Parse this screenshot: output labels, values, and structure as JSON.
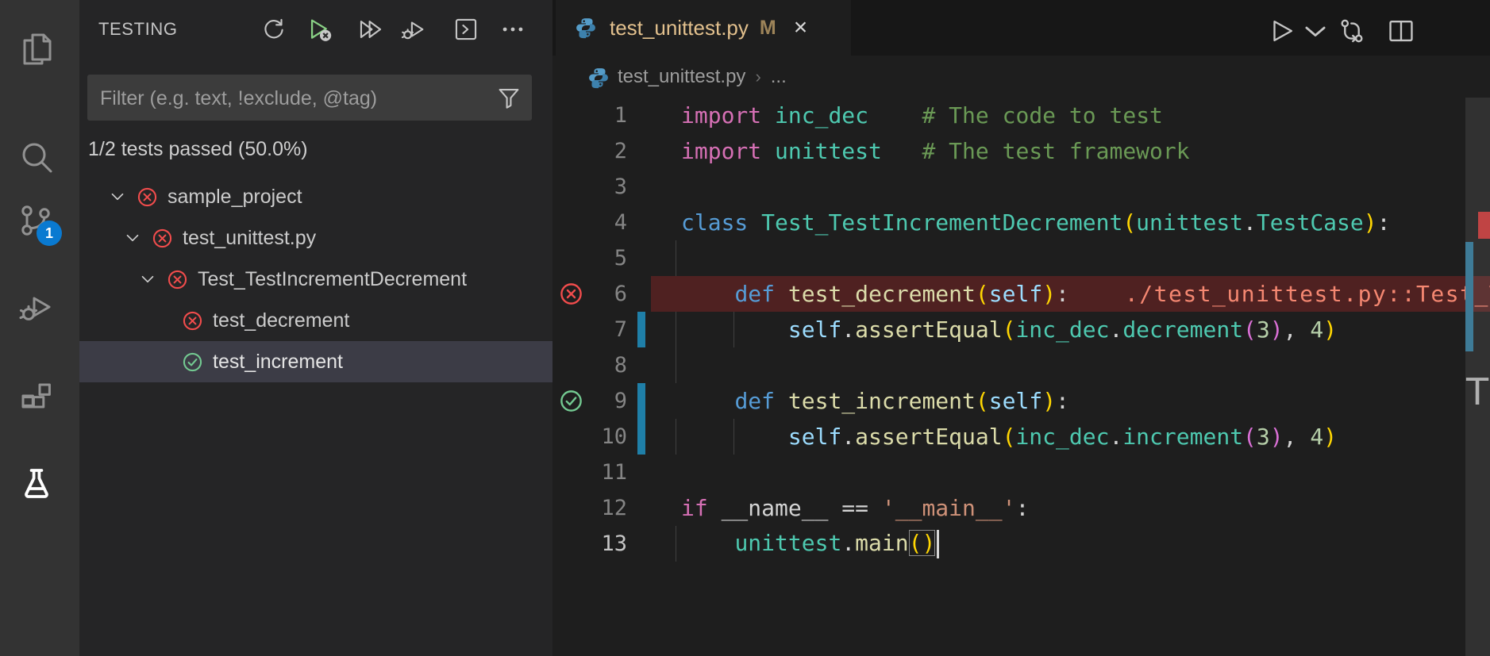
{
  "activity_bar": {
    "items": [
      {
        "icon": "explorer-icon"
      },
      {
        "icon": "search-icon"
      },
      {
        "icon": "source-control-icon",
        "badge": "1"
      },
      {
        "icon": "run-and-debug-icon"
      },
      {
        "icon": "extensions-icon"
      },
      {
        "icon": "testing-icon",
        "active": true
      }
    ]
  },
  "sidebar": {
    "title": "TESTING",
    "toolbar": [
      {
        "name": "refresh-tests"
      },
      {
        "name": "run-failed-tests"
      },
      {
        "name": "run-all-tests"
      },
      {
        "name": "debug-tests"
      },
      {
        "name": "show-output"
      },
      {
        "name": "more-actions"
      }
    ],
    "filter": {
      "placeholder": "Filter (e.g. text, !exclude, @tag)"
    },
    "summary": "1/2 tests passed (50.0%)",
    "tree": [
      {
        "label": "sample_project",
        "state": "fail",
        "level": 0,
        "expandable": true
      },
      {
        "label": "test_unittest.py",
        "state": "fail",
        "level": 1,
        "expandable": true
      },
      {
        "label": "Test_TestIncrementDecrement",
        "state": "fail",
        "level": 2,
        "expandable": true
      },
      {
        "label": "test_decrement",
        "state": "fail",
        "level": 3,
        "expandable": false
      },
      {
        "label": "test_increment",
        "state": "pass",
        "level": 3,
        "expandable": false,
        "selected": true
      }
    ]
  },
  "editor": {
    "tab": {
      "title": "test_unittest.py",
      "dirty_badge": "M",
      "close": "×",
      "icon": "python-icon"
    },
    "actions": [
      {
        "name": "run-file"
      },
      {
        "name": "run-dropdown-chevron"
      },
      {
        "name": "open-changes"
      },
      {
        "name": "split-editor"
      },
      {
        "name": "more-actions"
      }
    ],
    "breadcrumb": {
      "file": "test_unittest.py",
      "separator": "›",
      "more": "..."
    },
    "code": {
      "active_line": 13,
      "lines": [
        {
          "n": 1,
          "tk": [
            [
              "kwm",
              "import"
            ],
            [
              "t",
              " "
            ],
            [
              "type",
              "inc_dec"
            ],
            [
              "t",
              "    "
            ],
            [
              "cmt",
              "# The code to test"
            ]
          ]
        },
        {
          "n": 2,
          "tk": [
            [
              "kwm",
              "import"
            ],
            [
              "t",
              " "
            ],
            [
              "type",
              "unittest"
            ],
            [
              "t",
              "   "
            ],
            [
              "cmt",
              "# The test framework"
            ]
          ]
        },
        {
          "n": 3,
          "tk": []
        },
        {
          "n": 4,
          "tk": [
            [
              "kwb",
              "class"
            ],
            [
              "t",
              " "
            ],
            [
              "type",
              "Test_TestIncrementDecrement"
            ],
            [
              "b1",
              "("
            ],
            [
              "type",
              "unittest"
            ],
            [
              "t",
              "."
            ],
            [
              "type",
              "TestCase"
            ],
            [
              "b1",
              ")"
            ],
            [
              "t",
              ":"
            ]
          ]
        },
        {
          "n": 5,
          "tk": [],
          "guides": [
            155
          ]
        },
        {
          "n": 6,
          "highlight": true,
          "state": "fail",
          "tk": [
            [
              "t",
              "    "
            ],
            [
              "kwb",
              "def"
            ],
            [
              "t",
              " "
            ],
            [
              "fn",
              "test_decrement"
            ],
            [
              "b1",
              "("
            ],
            [
              "slf",
              "self"
            ],
            [
              "b1",
              ")"
            ],
            [
              "t",
              ":"
            ],
            [
              "err",
              "./test_unittest.py::Test_T"
            ]
          ]
        },
        {
          "n": 7,
          "changed": true,
          "guides": [
            155,
            228
          ],
          "tk": [
            [
              "t",
              "        "
            ],
            [
              "slf",
              "self"
            ],
            [
              "t",
              "."
            ],
            [
              "fn",
              "assertEqual"
            ],
            [
              "b1",
              "("
            ],
            [
              "type",
              "inc_dec"
            ],
            [
              "t",
              "."
            ],
            [
              "type",
              "decrement"
            ],
            [
              "b2",
              "("
            ],
            [
              "num",
              "3"
            ],
            [
              "b2",
              ")"
            ],
            [
              "t",
              ", "
            ],
            [
              "num",
              "4"
            ],
            [
              "b1",
              ")"
            ]
          ]
        },
        {
          "n": 8,
          "tk": [],
          "guides": [
            155
          ]
        },
        {
          "n": 9,
          "changed": true,
          "state": "pass",
          "tk": [
            [
              "t",
              "    "
            ],
            [
              "kwb",
              "def"
            ],
            [
              "t",
              " "
            ],
            [
              "fn",
              "test_increment"
            ],
            [
              "b1",
              "("
            ],
            [
              "slf",
              "self"
            ],
            [
              "b1",
              ")"
            ],
            [
              "t",
              ":"
            ]
          ]
        },
        {
          "n": 10,
          "changed": true,
          "guides": [
            155,
            228
          ],
          "tk": [
            [
              "t",
              "        "
            ],
            [
              "slf",
              "self"
            ],
            [
              "t",
              "."
            ],
            [
              "fn",
              "assertEqual"
            ],
            [
              "b1",
              "("
            ],
            [
              "type",
              "inc_dec"
            ],
            [
              "t",
              "."
            ],
            [
              "type",
              "increment"
            ],
            [
              "b2",
              "("
            ],
            [
              "num",
              "3"
            ],
            [
              "b2",
              ")"
            ],
            [
              "t",
              ", "
            ],
            [
              "num",
              "4"
            ],
            [
              "b1",
              ")"
            ]
          ]
        },
        {
          "n": 11,
          "tk": []
        },
        {
          "n": 12,
          "tk": [
            [
              "kwm",
              "if"
            ],
            [
              "t",
              " __name__ == "
            ],
            [
              "str",
              "'__main__'"
            ],
            [
              "t",
              ":"
            ]
          ]
        },
        {
          "n": 13,
          "cursor": true,
          "guides": [
            155
          ],
          "tk": [
            [
              "t",
              "    "
            ],
            [
              "type",
              "unittest"
            ],
            [
              "t",
              "."
            ],
            [
              "fn",
              "main"
            ],
            [
              "b1box",
              "()"
            ]
          ]
        }
      ]
    },
    "overview_ruler": {
      "markers": [
        {
          "type": "error",
          "color": "#c04444"
        },
        {
          "type": "modified-lines",
          "color": "#3e7b97"
        }
      ],
      "clipped_text": "T"
    }
  },
  "colors": {
    "kwm": "#d670b5",
    "kwb": "#569cd6",
    "type": "#4ec9b0",
    "fn": "#dcdcaa",
    "num": "#b5cea8",
    "str": "#ce9178",
    "t": "#d4d4d4",
    "cmt": "#6a9955",
    "slf": "#9cdcfe",
    "b1": "#ffd602",
    "b1box": "#ffd602",
    "b2": "#da70d6",
    "err": "#f48771",
    "fail": "#f14c4c",
    "pass": "#73c991",
    "accent_badge": "#0a7ad1",
    "modified_tab": "#e2c08d"
  }
}
